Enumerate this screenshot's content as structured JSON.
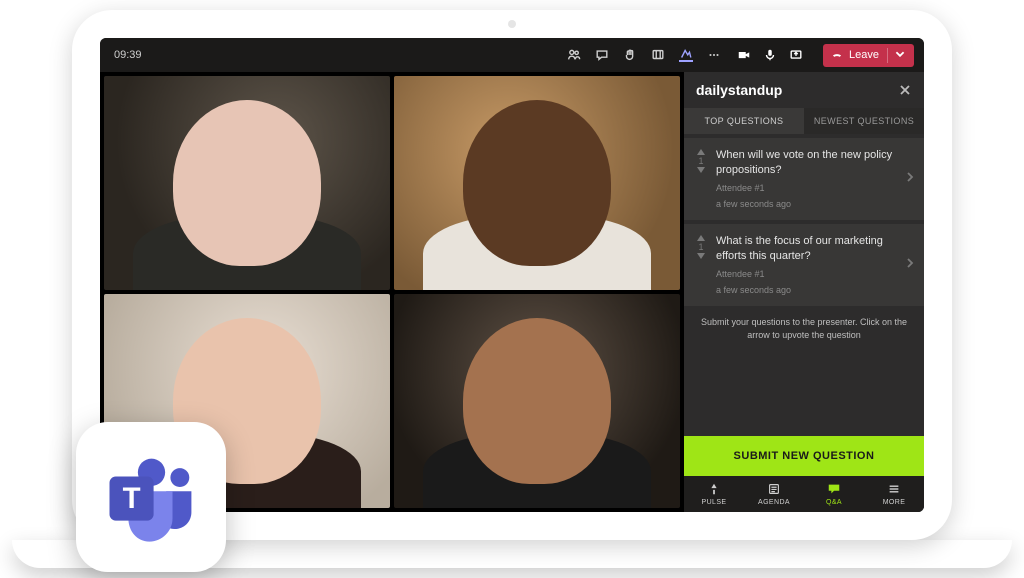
{
  "toolbar": {
    "time": "09:39",
    "leave_label": "Leave"
  },
  "panel": {
    "title": "dailystandup",
    "tabs": {
      "top": "TOP QUESTIONS",
      "newest": "NEWEST QUESTIONS"
    },
    "questions": [
      {
        "votes": "1",
        "text": "When will we vote on the new policy propositions?",
        "author": "Attendee #1",
        "time": "a few seconds ago"
      },
      {
        "votes": "1",
        "text": "What is the focus of our marketing efforts this quarter?",
        "author": "Attendee #1",
        "time": "a few seconds ago"
      }
    ],
    "instruction": "Submit your questions to the presenter. Click on the arrow to upvote the question",
    "submit_label": "SUBMIT NEW QUESTION",
    "bottom_nav": {
      "pulse": "PULSE",
      "agenda": "AGENDA",
      "qa": "Q&A",
      "more": "MORE"
    }
  },
  "colors": {
    "accent_green": "#9fe516",
    "leave_red": "#c4314b"
  }
}
